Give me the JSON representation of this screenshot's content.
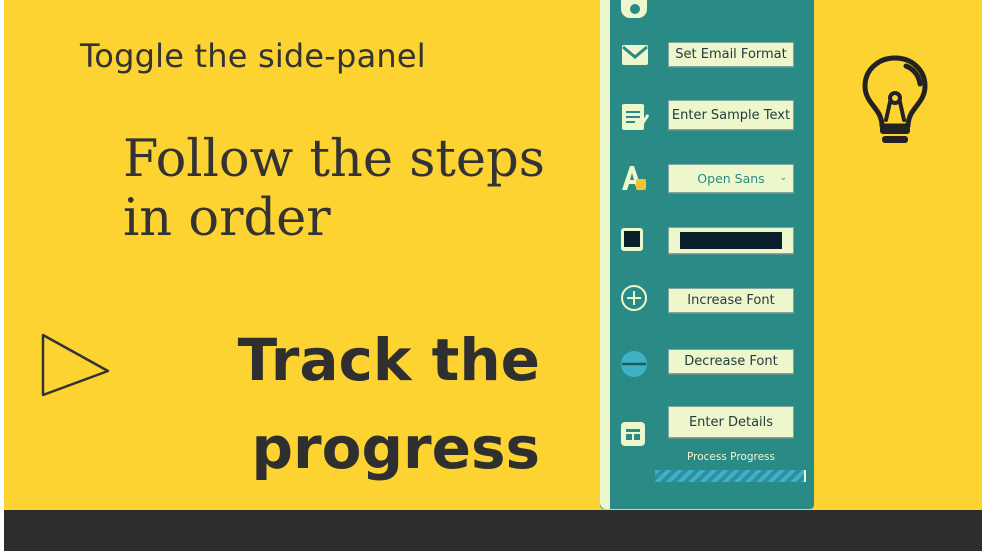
{
  "slide": {
    "hint_text": "Toggle the side-panel",
    "steps_text": "Follow the steps in order",
    "track_line1": "Track the",
    "track_line2": "progress"
  },
  "icons": {
    "play": "triangle-play-icon",
    "bulb": "lightbulb-icon",
    "toggle": "toggle-icon",
    "email": "mail-icon",
    "notes": "notepad-icon",
    "font": "font-icon",
    "color": "color-square-icon",
    "plus": "plus-circle-icon",
    "minus": "minus-circle-icon",
    "calendar": "calendar-icon"
  },
  "panel": {
    "email_button": "Set Email Format",
    "sample_button": "Enter Sample Text",
    "font_select_value": "Open Sans",
    "color_value": "#0b1f2a",
    "increase_button": "Increase Font",
    "decrease_button": "Decrease Font",
    "details_button": "Enter Details",
    "progress_label": "Process Progress",
    "progress_fraction": 0.99
  },
  "colors": {
    "background": "#fdd331",
    "panel": "#2a8a86",
    "panel_light": "#eef7cc",
    "text_dark": "#333333",
    "bottom_bar": "#2d2d2d"
  }
}
